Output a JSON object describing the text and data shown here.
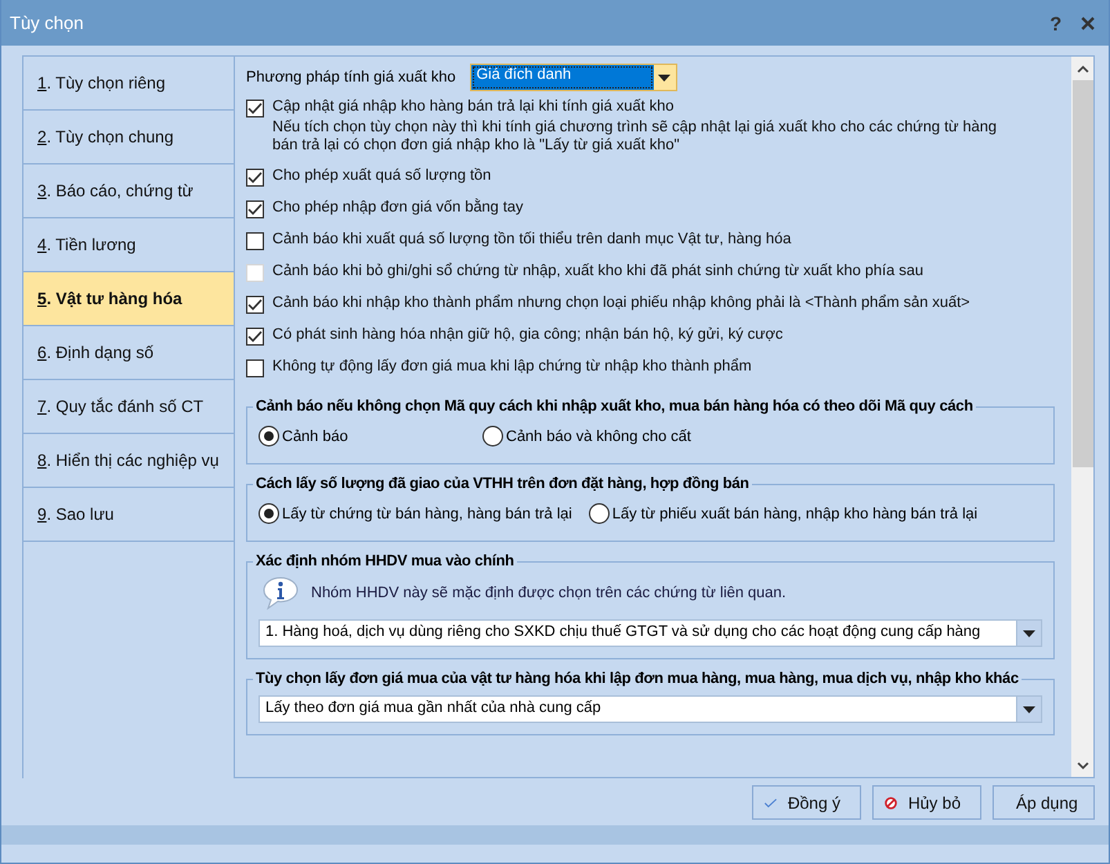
{
  "window": {
    "title": "Tùy chọn",
    "help": "?"
  },
  "nav": [
    {
      "key": "1",
      "label": ". Tùy chọn riêng",
      "selected": false
    },
    {
      "key": "2",
      "label": ". Tùy chọn chung",
      "selected": false
    },
    {
      "key": "3",
      "label": ". Báo cáo, chứng từ",
      "selected": false
    },
    {
      "key": "4",
      "label": ". Tiền lương",
      "selected": false
    },
    {
      "key": "5",
      "label": ". Vật tư hàng hóa",
      "selected": true
    },
    {
      "key": "6",
      "label": ". Định dạng số",
      "selected": false
    },
    {
      "key": "7",
      "label": ". Quy tắc đánh số CT",
      "selected": false
    },
    {
      "key": "8",
      "label": ". Hiển thị các nghiệp vụ",
      "selected": false
    },
    {
      "key": "9",
      "label": ". Sao lưu",
      "selected": false
    }
  ],
  "costing": {
    "label": "Phương pháp tính giá xuất kho",
    "value": "Giá đích danh"
  },
  "options": [
    {
      "label": "Cập nhật giá nhập kho hàng bán trả lại khi tính giá xuất kho",
      "note": "Nếu tích chọn tùy chọn này thì khi tính giá chương trình sẽ cập nhật lại giá xuất kho cho các chứng từ hàng bán trả lại có chọn đơn giá nhập kho là \"Lấy từ giá xuất kho\"",
      "checked": true,
      "disabled": false
    },
    {
      "label": "Cho phép xuất quá số lượng tồn",
      "checked": true,
      "disabled": false
    },
    {
      "label": "Cho phép nhập đơn giá vốn bằng tay",
      "checked": true,
      "disabled": false
    },
    {
      "label": "Cảnh báo khi xuất quá số lượng tồn tối thiểu trên danh mục Vật tư, hàng hóa",
      "checked": false,
      "disabled": false
    },
    {
      "label": "Cảnh báo khi bỏ ghi/ghi sổ chứng từ nhập, xuất kho khi đã phát sinh chứng từ xuất kho phía sau",
      "checked": false,
      "disabled": true
    },
    {
      "label": "Cảnh báo khi nhập kho thành phẩm nhưng chọn loại phiếu nhập không phải là <Thành phẩm sản xuất>",
      "checked": true,
      "disabled": false
    },
    {
      "label": "Có phát sinh hàng hóa nhận giữ hộ, gia công; nhận bán hộ, ký gửi, ký cược",
      "checked": true,
      "disabled": false
    },
    {
      "label": "Không tự động lấy đơn giá mua khi lập chứng từ nhập kho thành phẩm",
      "checked": false,
      "disabled": false
    }
  ],
  "groups": [
    {
      "kind": "radio",
      "title": "Cảnh báo nếu không chọn Mã quy cách khi nhập xuất kho, mua bán hàng hóa có theo dõi Mã quy cách",
      "options": [
        {
          "label": "Cảnh báo",
          "selected": true
        },
        {
          "label": "Cảnh báo và không cho cất",
          "selected": false
        }
      ]
    },
    {
      "kind": "radio",
      "title": "Cách lấy số lượng đã giao của VTHH trên đơn đặt hàng, hợp đồng bán",
      "options": [
        {
          "label": "Lấy từ chứng từ bán hàng, hàng bán trả lại",
          "selected": true
        },
        {
          "label": "Lấy từ phiếu xuất bán hàng, nhập kho hàng bán trả lại",
          "selected": false
        }
      ]
    },
    {
      "kind": "select",
      "title": "Xác định nhóm HHDV mua vào chính",
      "info": "Nhóm HHDV này sẽ mặc định được chọn trên các chứng từ liên quan.",
      "value": "1. Hàng hoá, dịch vụ dùng riêng cho SXKD chịu thuế GTGT và sử dụng cho các hoạt động cung cấp hàng"
    },
    {
      "kind": "select",
      "title": "Tùy chọn lấy đơn giá mua của vật tư hàng hóa khi lập đơn mua hàng, mua hàng, mua dịch vụ, nhập kho khác",
      "value": "Lấy theo đơn giá mua gần nhất của nhà cung cấp"
    }
  ],
  "buttons": [
    {
      "kind": "ok",
      "label": "Đồng ý"
    },
    {
      "kind": "cancel",
      "label": "Hủy bỏ"
    },
    {
      "kind": "apply",
      "label": "Áp dụng"
    }
  ]
}
